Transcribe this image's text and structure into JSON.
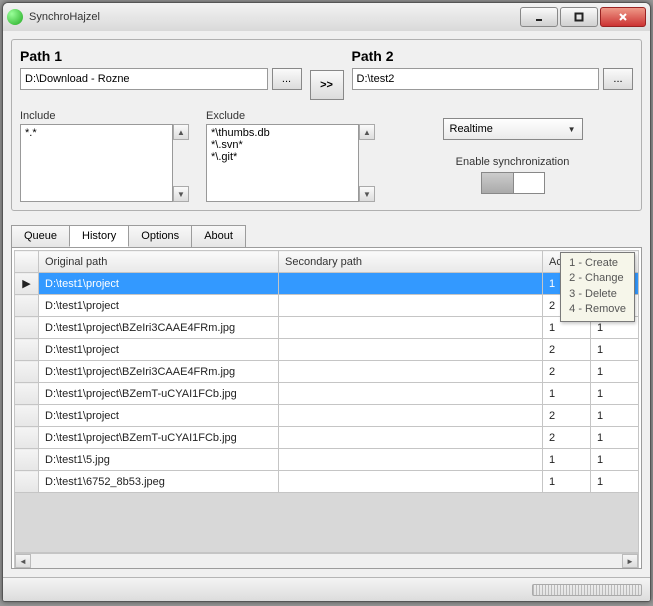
{
  "window": {
    "title": "SynchroHajzel"
  },
  "paths": {
    "path1_label": "Path 1",
    "path1_value": "D:\\Download - Rozne",
    "path2_label": "Path 2",
    "path2_value": "D:\\test2",
    "browse_label": "...",
    "swap_label": ">>"
  },
  "filters": {
    "include_label": "Include",
    "include_value": "*.*",
    "exclude_label": "Exclude",
    "exclude_value": "*\\thumbs.db\n*\\.svn*\n*\\.git*"
  },
  "mode": {
    "selected": "Realtime"
  },
  "sync": {
    "label": "Enable synchronization"
  },
  "tabs": {
    "t0": "Queue",
    "t1": "History",
    "t2": "Options",
    "t3": "About"
  },
  "grid": {
    "h_rowhead": "",
    "h_orig": "Original path",
    "h_sec": "Secondary path",
    "h_act": "Action",
    "rows": [
      {
        "orig": "D:\\test1\\project",
        "sec": "",
        "a1": "1",
        "a2": ""
      },
      {
        "orig": "D:\\test1\\project",
        "sec": "",
        "a1": "2",
        "a2": ""
      },
      {
        "orig": "D:\\test1\\project\\BZeIri3CAAE4FRm.jpg",
        "sec": "",
        "a1": "1",
        "a2": "1"
      },
      {
        "orig": "D:\\test1\\project",
        "sec": "",
        "a1": "2",
        "a2": "1"
      },
      {
        "orig": "D:\\test1\\project\\BZeIri3CAAE4FRm.jpg",
        "sec": "",
        "a1": "2",
        "a2": "1"
      },
      {
        "orig": "D:\\test1\\project\\BZemT-uCYAI1FCb.jpg",
        "sec": "",
        "a1": "1",
        "a2": "1"
      },
      {
        "orig": "D:\\test1\\project",
        "sec": "",
        "a1": "2",
        "a2": "1"
      },
      {
        "orig": "D:\\test1\\project\\BZemT-uCYAI1FCb.jpg",
        "sec": "",
        "a1": "2",
        "a2": "1"
      },
      {
        "orig": "D:\\test1\\5.jpg",
        "sec": "",
        "a1": "1",
        "a2": "1"
      },
      {
        "orig": "D:\\test1\\6752_8b53.jpeg",
        "sec": "",
        "a1": "1",
        "a2": "1"
      }
    ]
  },
  "tooltip": {
    "l1": "1 - Create",
    "l2": "2 - Change",
    "l3": "3 - Delete",
    "l4": "4 - Remove"
  }
}
